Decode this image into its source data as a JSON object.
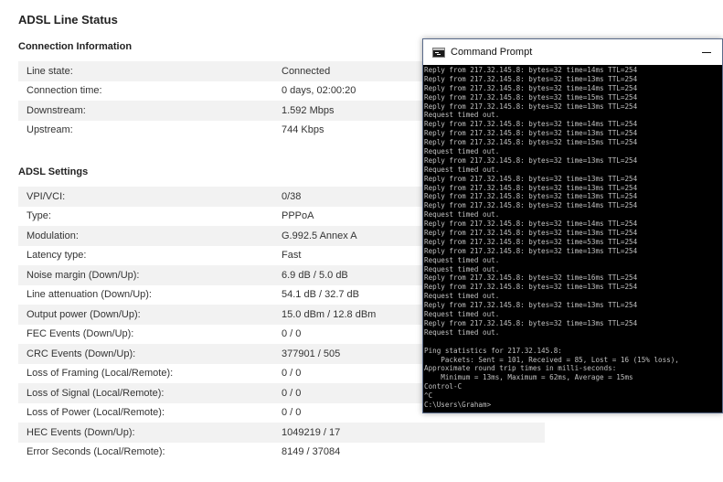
{
  "page": {
    "title": "ADSL Line Status"
  },
  "connection": {
    "heading": "Connection Information",
    "rows": [
      {
        "label": "Line state:",
        "value": "Connected"
      },
      {
        "label": "Connection time:",
        "value": "0 days, 02:00:20"
      },
      {
        "label": "Downstream:",
        "value": "1.592 Mbps"
      },
      {
        "label": "Upstream:",
        "value": "744 Kbps"
      }
    ]
  },
  "adsl": {
    "heading": "ADSL Settings",
    "rows": [
      {
        "label": "VPI/VCI:",
        "value": "0/38"
      },
      {
        "label": "Type:",
        "value": "PPPoA"
      },
      {
        "label": "Modulation:",
        "value": "G.992.5 Annex A"
      },
      {
        "label": "Latency type:",
        "value": "Fast"
      },
      {
        "label": "Noise margin (Down/Up):",
        "value": "6.9 dB / 5.0 dB"
      },
      {
        "label": "Line attenuation (Down/Up):",
        "value": "54.1 dB / 32.7 dB"
      },
      {
        "label": "Output power (Down/Up):",
        "value": "15.0 dBm / 12.8 dBm"
      },
      {
        "label": "FEC Events (Down/Up):",
        "value": "0 / 0"
      },
      {
        "label": "CRC Events (Down/Up):",
        "value": "377901 / 505"
      },
      {
        "label": "Loss of Framing (Local/Remote):",
        "value": "0 / 0"
      },
      {
        "label": "Loss of Signal (Local/Remote):",
        "value": "0 / 0"
      },
      {
        "label": "Loss of Power (Local/Remote):",
        "value": "0 / 0"
      },
      {
        "label": "HEC Events (Down/Up):",
        "value": "1049219 / 17"
      },
      {
        "label": "Error Seconds (Local/Remote):",
        "value": "8149 / 37084"
      }
    ]
  },
  "cmd": {
    "title": "Command Prompt",
    "icon": "console-icon",
    "lines": [
      "Reply from 217.32.145.8: bytes=32 time=14ms TTL=254",
      "Reply from 217.32.145.8: bytes=32 time=13ms TTL=254",
      "Reply from 217.32.145.8: bytes=32 time=14ms TTL=254",
      "Reply from 217.32.145.8: bytes=32 time=15ms TTL=254",
      "Reply from 217.32.145.8: bytes=32 time=13ms TTL=254",
      "Request timed out.",
      "Reply from 217.32.145.8: bytes=32 time=14ms TTL=254",
      "Reply from 217.32.145.8: bytes=32 time=13ms TTL=254",
      "Reply from 217.32.145.8: bytes=32 time=15ms TTL=254",
      "Request timed out.",
      "Reply from 217.32.145.8: bytes=32 time=13ms TTL=254",
      "Request timed out.",
      "Reply from 217.32.145.8: bytes=32 time=13ms TTL=254",
      "Reply from 217.32.145.8: bytes=32 time=13ms TTL=254",
      "Reply from 217.32.145.8: bytes=32 time=13ms TTL=254",
      "Reply from 217.32.145.8: bytes=32 time=14ms TTL=254",
      "Request timed out.",
      "Reply from 217.32.145.8: bytes=32 time=14ms TTL=254",
      "Reply from 217.32.145.8: bytes=32 time=13ms TTL=254",
      "Reply from 217.32.145.8: bytes=32 time=53ms TTL=254",
      "Reply from 217.32.145.8: bytes=32 time=13ms TTL=254",
      "Request timed out.",
      "Request timed out.",
      "Reply from 217.32.145.8: bytes=32 time=16ms TTL=254",
      "Reply from 217.32.145.8: bytes=32 time=13ms TTL=254",
      "Request timed out.",
      "Reply from 217.32.145.8: bytes=32 time=13ms TTL=254",
      "Request timed out.",
      "Reply from 217.32.145.8: bytes=32 time=13ms TTL=254",
      "Request timed out.",
      "",
      "Ping statistics for 217.32.145.8:",
      "    Packets: Sent = 101, Received = 85, Lost = 16 (15% loss),",
      "Approximate round trip times in milli-seconds:",
      "    Minimum = 13ms, Maximum = 62ms, Average = 15ms",
      "Control-C",
      "^C",
      "C:\\Users\\Graham>"
    ]
  }
}
